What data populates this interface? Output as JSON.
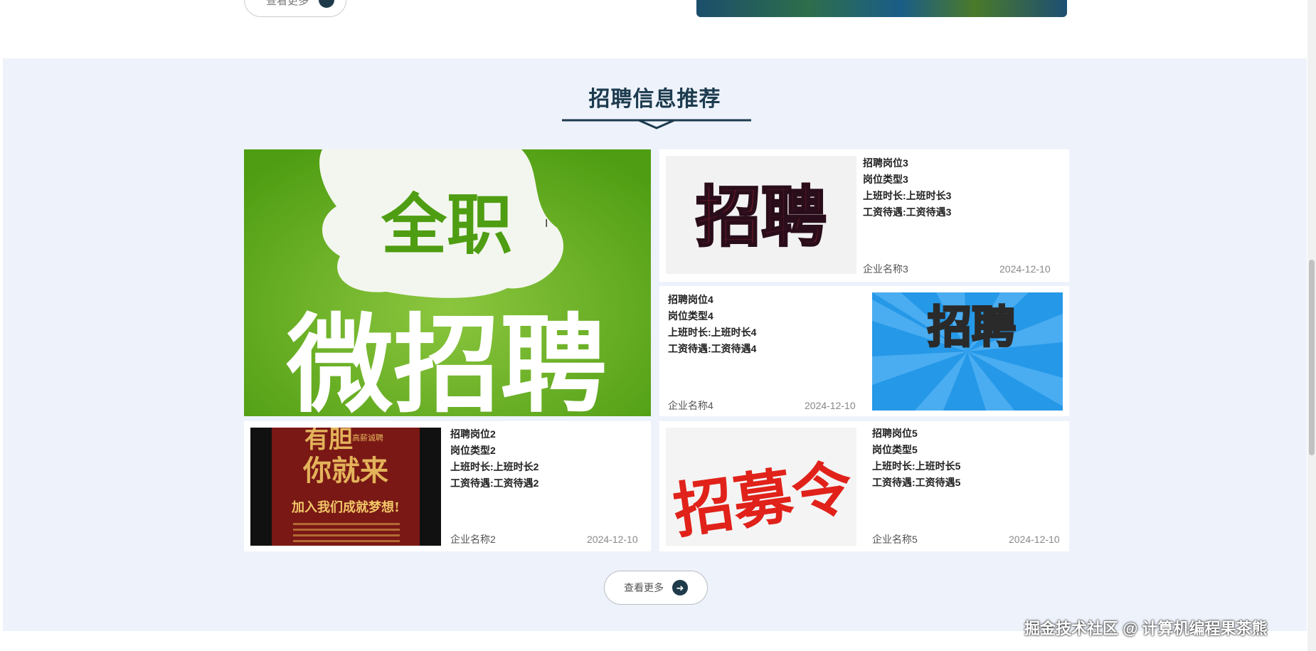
{
  "top": {
    "more_label": "查看更多"
  },
  "section": {
    "title": "招聘信息推荐",
    "featured": {
      "line1": "全职",
      "line2": "微招聘"
    },
    "cards": [
      {
        "id": "card3",
        "position": "招聘岗位3",
        "type": "岗位类型3",
        "hours": "上班时长:上班时长3",
        "salary": "工资待遇:工资待遇3",
        "company": "企业名称3",
        "date": "2024-12-10",
        "image_text": "招聘"
      },
      {
        "id": "card4",
        "position": "招聘岗位4",
        "type": "岗位类型4",
        "hours": "上班时长:上班时长4",
        "salary": "工资待遇:工资待遇4",
        "company": "企业名称4",
        "date": "2024-12-10",
        "image_text": "招聘"
      },
      {
        "id": "card2",
        "position": "招聘岗位2",
        "type": "岗位类型2",
        "hours": "上班时长:上班时长2",
        "salary": "工资待遇:工资待遇2",
        "company": "企业名称2",
        "date": "2024-12-10",
        "image_text_1": "有胆",
        "image_text_2": "你就来",
        "image_text_3": "加入我们成就梦想!",
        "image_badge": "高薪诚聘"
      },
      {
        "id": "card5",
        "position": "招聘岗位5",
        "type": "岗位类型5",
        "hours": "上班时长:上班时长5",
        "salary": "工资待遇:工资待遇5",
        "company": "企业名称5",
        "date": "2024-12-10",
        "image_text": "招募令"
      }
    ],
    "more_label": "查看更多"
  },
  "watermark": "掘金技术社区 @ 计算机编程果茶熊",
  "colors": {
    "section_bg": "#eef3fb",
    "title": "#1d3b4f",
    "accent_green": "#5aa51e"
  }
}
